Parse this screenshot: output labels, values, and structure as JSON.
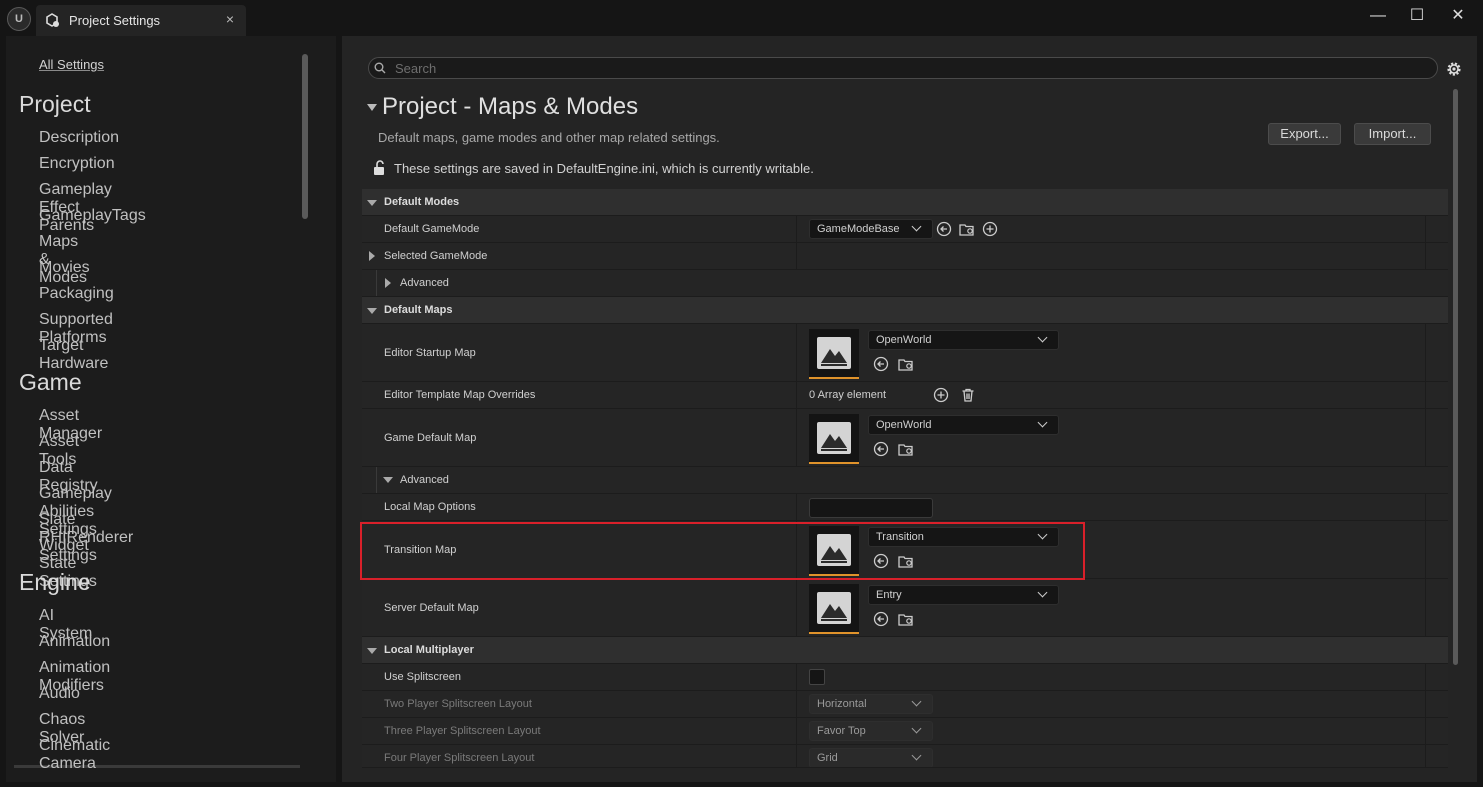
{
  "window": {
    "tab_title": "Project Settings",
    "tab_close": "×",
    "minimize": "—",
    "maximize": "☐",
    "close": "✕"
  },
  "sidebar": {
    "all_settings": "All Settings",
    "categories": [
      {
        "title": "Project",
        "items": [
          "Description",
          "Encryption",
          "Gameplay Effect Parents",
          "GameplayTags",
          "Maps & Modes",
          "Movies",
          "Packaging",
          "Supported Platforms",
          "Target Hardware"
        ]
      },
      {
        "title": "Game",
        "items": [
          "Asset Manager",
          "Asset Tools",
          "Data Registry",
          "Gameplay Abilities Settings",
          "Slate RHIRenderer Settings",
          "Widget State Settings"
        ]
      },
      {
        "title": "Engine",
        "items": [
          "AI System",
          "Animation",
          "Animation Modifiers",
          "Audio",
          "Chaos Solver",
          "Cinematic Camera"
        ]
      }
    ],
    "selected_item": "Maps & Modes"
  },
  "search": {
    "placeholder": "Search"
  },
  "page": {
    "title": "Project - Maps & Modes",
    "description": "Default maps, game modes and other map related settings.",
    "export_label": "Export...",
    "import_label": "Import...",
    "writable_notice": "These settings are saved in DefaultEngine.ini, which is currently writable."
  },
  "sections": {
    "default_modes": {
      "title": "Default Modes",
      "default_gamemode_label": "Default GameMode",
      "default_gamemode_value": "GameModeBase",
      "selected_gamemode_label": "Selected GameMode",
      "advanced_label": "Advanced"
    },
    "default_maps": {
      "title": "Default Maps",
      "editor_startup_map_label": "Editor Startup Map",
      "editor_startup_map_value": "OpenWorld",
      "editor_template_overrides_label": "Editor Template Map Overrides",
      "editor_template_overrides_value": "0 Array element",
      "game_default_map_label": "Game Default Map",
      "game_default_map_value": "OpenWorld",
      "advanced_label": "Advanced",
      "local_map_options_label": "Local Map Options",
      "local_map_options_value": "",
      "transition_map_label": "Transition Map",
      "transition_map_value": "Transition",
      "server_default_map_label": "Server Default Map",
      "server_default_map_value": "Entry"
    },
    "local_multiplayer": {
      "title": "Local Multiplayer",
      "use_splitscreen_label": "Use Splitscreen",
      "use_splitscreen_checked": false,
      "two_player_label": "Two Player Splitscreen Layout",
      "two_player_value": "Horizontal",
      "three_player_label": "Three Player Splitscreen Layout",
      "three_player_value": "Favor Top",
      "four_player_label": "Four Player Splitscreen Layout",
      "four_player_value": "Grid"
    }
  },
  "colors": {
    "accent_orange": "#e0932b",
    "highlight_red": "#d9202a"
  }
}
